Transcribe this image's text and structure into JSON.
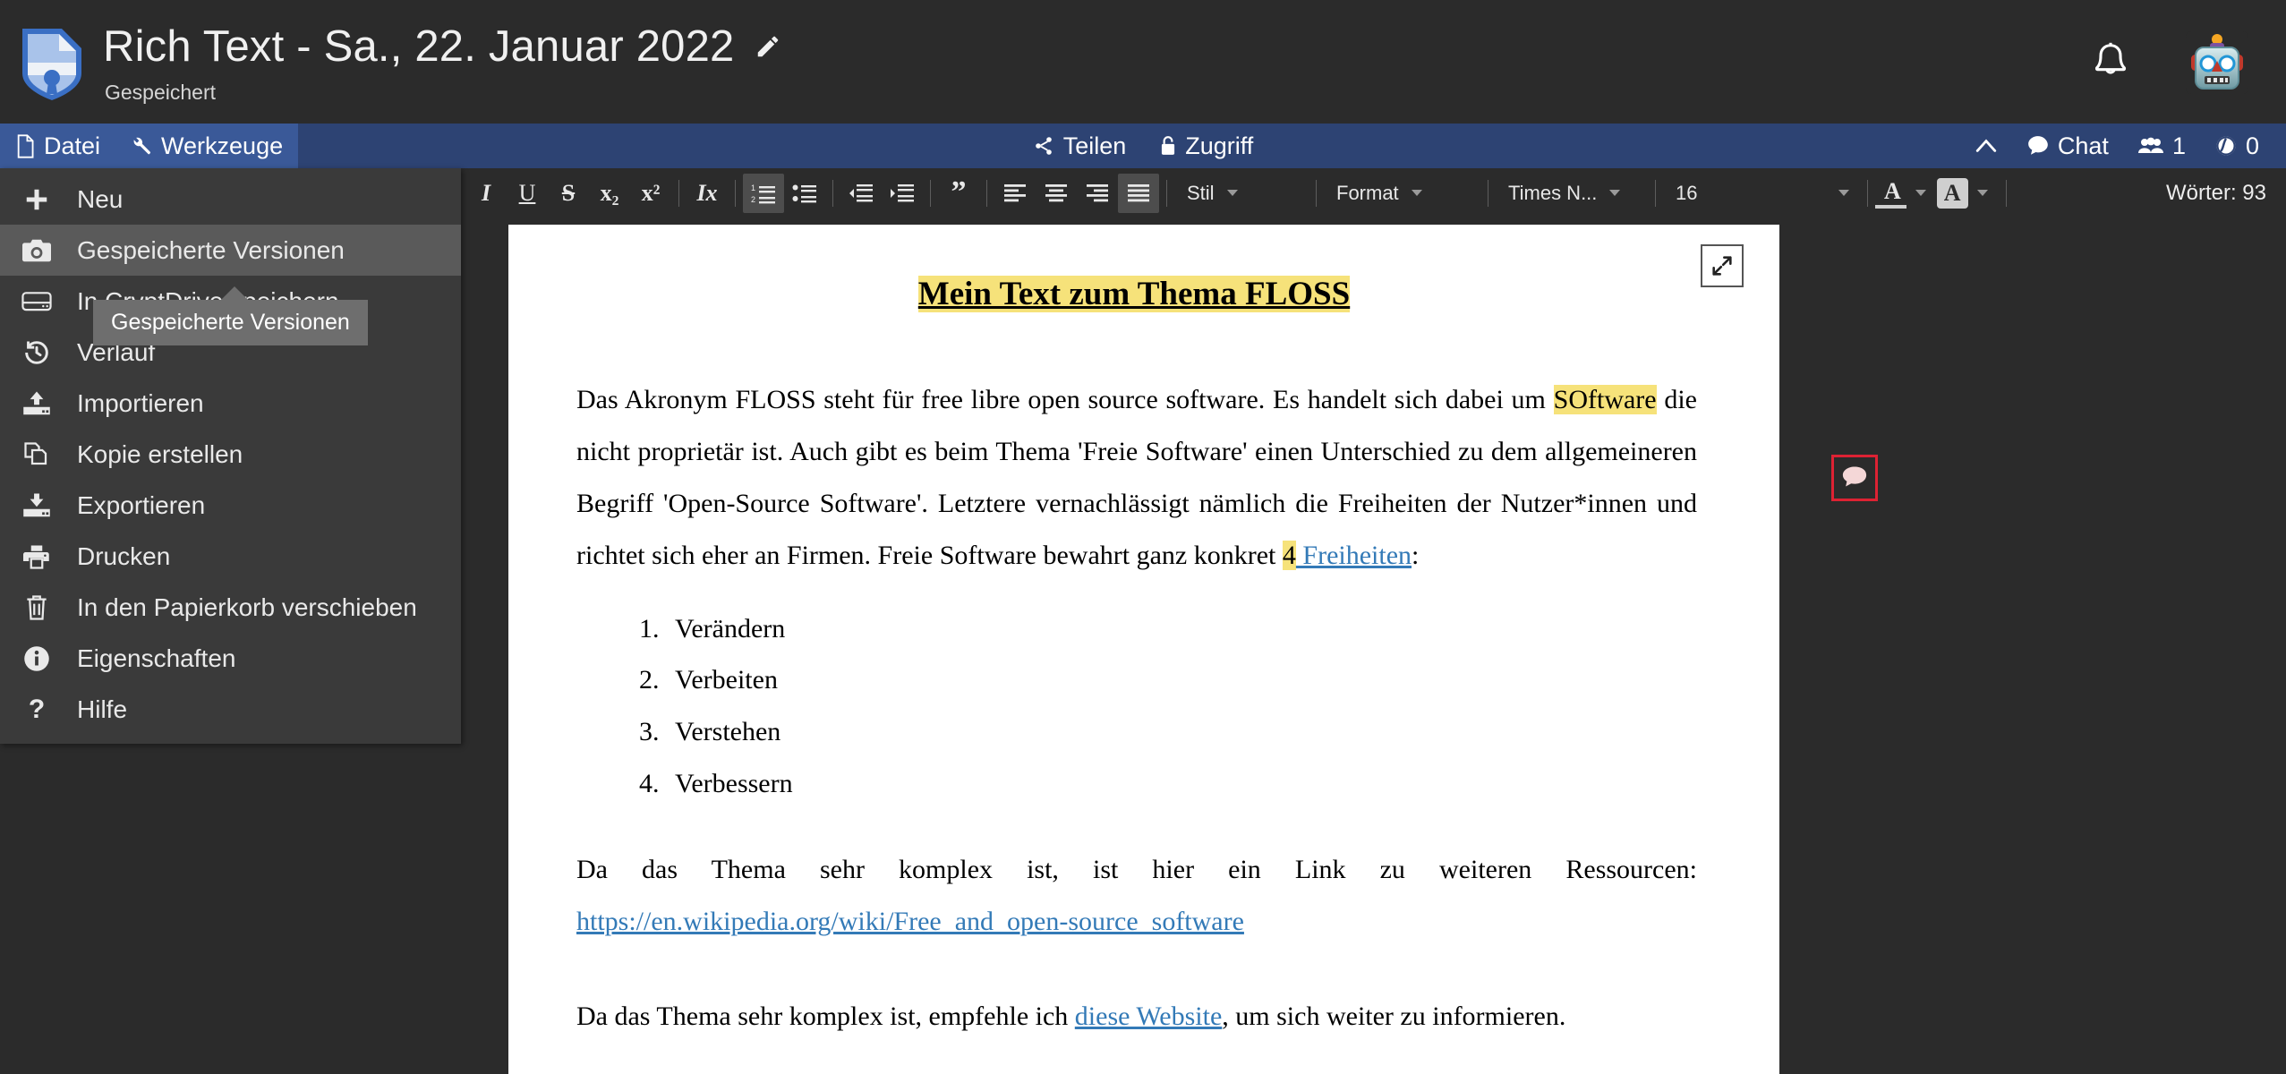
{
  "app": {
    "logo_icon": "cryptpad-shield-document-icon",
    "document_title": "Rich Text - Sa., 22. Januar 2022",
    "edit_title_icon": "pencil-icon",
    "save_status": "Gespeichert",
    "notifications_icon": "bell-icon",
    "avatar_icon": "robot-avatar",
    "accent_blue": "#3a5998",
    "bar_blue": "#2d4373",
    "dark_bg": "#2b2b2b",
    "menu_bg": "#3a3a3a",
    "highlight_yellow": "#f6e27a",
    "link_blue": "#337ab7",
    "comment_red": "#dd2233"
  },
  "menubar": {
    "left_items": [
      {
        "label": "Datei",
        "icon": "file-icon"
      },
      {
        "label": "Werkzeuge",
        "icon": "wrench-icon"
      }
    ],
    "center_items": [
      {
        "label": "Teilen",
        "icon": "share-icon"
      },
      {
        "label": "Zugriff",
        "icon": "lock-icon"
      }
    ],
    "right_items": [
      {
        "label": "",
        "icon": "chevron-up-icon"
      },
      {
        "label": "Chat",
        "icon": "chat-bubble-icon"
      },
      {
        "label": "1",
        "icon": "users-icon"
      },
      {
        "label": "0",
        "icon": "eye-icon"
      }
    ]
  },
  "file_menu": {
    "items": [
      {
        "label": "Neu",
        "icon": "plus-icon",
        "highlighted": false
      },
      {
        "label": "Gespeicherte Versionen",
        "icon": "camera-icon",
        "highlighted": true
      },
      {
        "label": "In CryptDrive speichern",
        "icon": "drive-icon",
        "highlighted": false
      },
      {
        "label": "Verlauf",
        "icon": "history-icon",
        "highlighted": false
      },
      {
        "label": "Importieren",
        "icon": "import-icon",
        "highlighted": false
      },
      {
        "label": "Kopie erstellen",
        "icon": "copy-icon",
        "highlighted": false
      },
      {
        "label": "Exportieren",
        "icon": "export-icon",
        "highlighted": false
      },
      {
        "label": "Drucken",
        "icon": "printer-icon",
        "highlighted": false
      },
      {
        "label": "In den Papierkorb verschieben",
        "icon": "trash-icon",
        "highlighted": false
      },
      {
        "label": "Eigenschaften",
        "icon": "info-icon",
        "highlighted": false
      },
      {
        "label": "Hilfe",
        "icon": "question-icon",
        "highlighted": false
      }
    ],
    "tooltip": "Gespeicherte Versionen"
  },
  "format_toolbar": {
    "buttons": [
      {
        "name": "italic",
        "glyph": "I",
        "active": false
      },
      {
        "name": "underline",
        "glyph": "U",
        "active": false
      },
      {
        "name": "strikethrough",
        "glyph": "S",
        "active": false
      },
      {
        "name": "subscript",
        "glyph": "x₂",
        "active": false
      },
      {
        "name": "superscript",
        "glyph": "x²",
        "active": false
      }
    ],
    "clear_format": {
      "name": "remove-format",
      "glyph": "Ix"
    },
    "lists": [
      {
        "name": "numbered-list",
        "active": true
      },
      {
        "name": "bullet-list",
        "active": false
      }
    ],
    "indent": [
      {
        "name": "outdent",
        "active": false
      },
      {
        "name": "indent",
        "active": false
      }
    ],
    "blockquote": {
      "name": "blockquote",
      "active": false
    },
    "align": [
      {
        "name": "align-left",
        "active": false
      },
      {
        "name": "align-center",
        "active": false
      },
      {
        "name": "align-right",
        "active": false
      },
      {
        "name": "align-justify",
        "active": true
      }
    ],
    "selects": [
      {
        "name": "style",
        "label": "Stil"
      },
      {
        "name": "format",
        "label": "Format"
      },
      {
        "name": "font",
        "label": "Times N..."
      },
      {
        "name": "size",
        "label": "16"
      }
    ],
    "color_buttons": [
      {
        "name": "text-color",
        "glyph": "A"
      },
      {
        "name": "highlight-color",
        "glyph": "A"
      }
    ],
    "word_count": "Wörter: 93"
  },
  "document": {
    "expand_icon": "expand-arrows-icon",
    "comment_icon": "comment-bubble-icon",
    "heading": "Mein Text zum Thema FLOSS",
    "p1": {
      "a": "Das Akronym FLOSS steht für free libre open source software. Es handelt sich dabei um ",
      "highlight": "SOftware",
      "b": " die nicht proprietär ist. Auch gibt es beim Thema 'Freie Software' einen Unterschied zu dem allgemeineren Begriff 'Open-Source Software'. Letztere vernachlässigt nämlich die Freiheiten der Nutzer*innen und richtet sich eher an Firmen. Freie Software bewahrt ganz konkret ",
      "num_highlight": "4",
      "link": " Freiheiten",
      "c": ":"
    },
    "list": [
      "Verändern",
      "Verbeiten",
      "Verstehen",
      "Verbessern"
    ],
    "p2": {
      "a": "Da das Thema sehr komplex ist, ist hier ein Link zu weiteren Ressourcen: ",
      "link": "https://en.wikipedia.org/wiki/Free_and_open-source_software"
    },
    "p3": {
      "a": "Da das Thema sehr komplex ist, empfehle ich ",
      "link": "diese Website",
      "b": ", um sich weiter zu informieren."
    }
  }
}
